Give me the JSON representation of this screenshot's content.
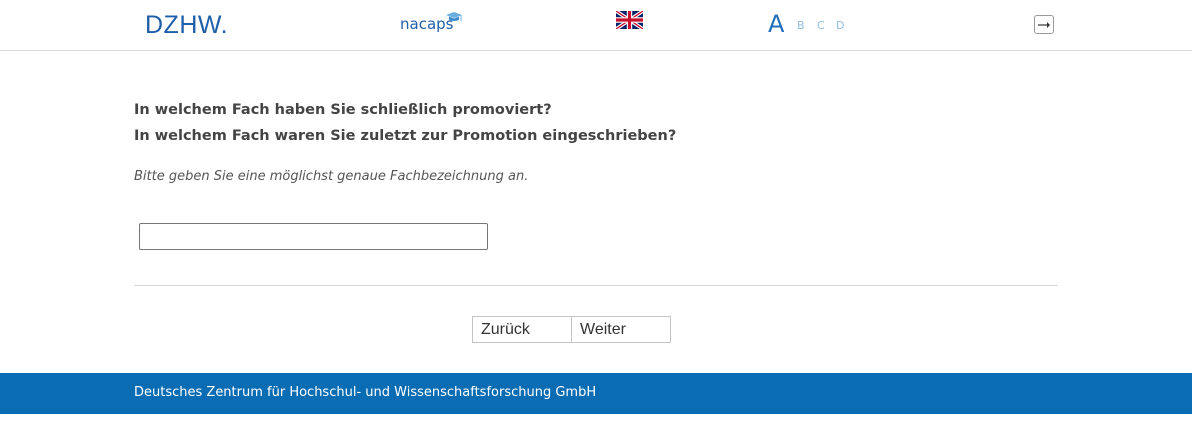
{
  "header": {
    "logo_dzhw": "DZHW.",
    "logo_nacaps": "nacaps",
    "language_icon": "uk-flag-icon",
    "font_sizes": [
      "A",
      "B",
      "C",
      "D"
    ],
    "logout_icon": "logout-icon"
  },
  "question": {
    "line1": "In welchem Fach haben Sie schließlich promoviert?",
    "line2": "In welchem Fach waren Sie zuletzt zur Promotion eingeschrieben?",
    "instruction": "Bitte geben Sie eine möglichst genaue Fachbezeichnung an.",
    "answer_value": ""
  },
  "navigation": {
    "back_label": "Zurück",
    "next_label": "Weiter"
  },
  "footer": {
    "text": "Deutsches Zentrum für Hochschul- und Wissenschaftsforschung GmbH"
  },
  "colors": {
    "brand_blue": "#1f5ea8",
    "footer_blue": "#0a6db3"
  }
}
